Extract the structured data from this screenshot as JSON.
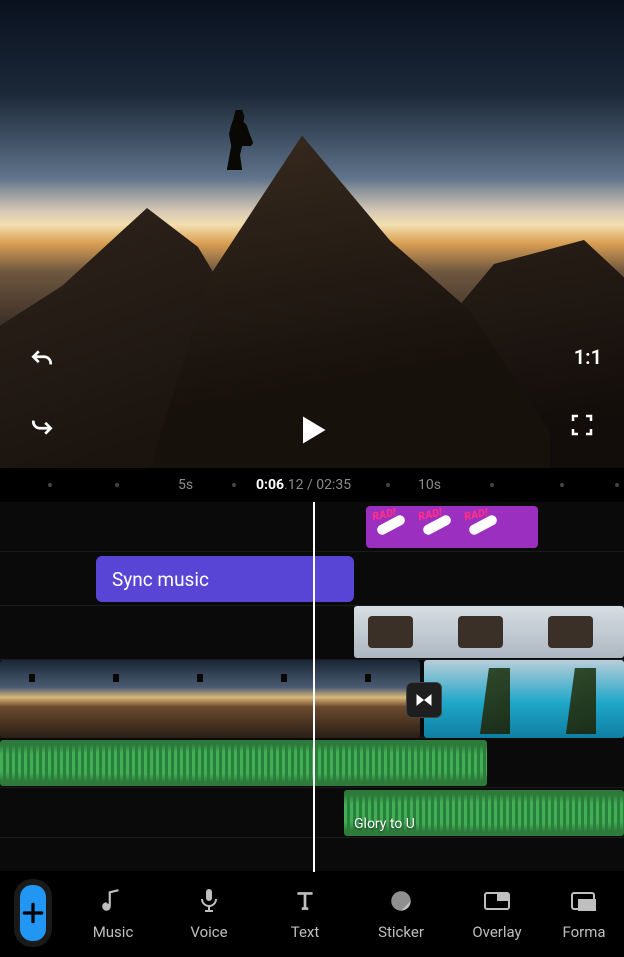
{
  "preview": {
    "aspect_ratio": "1:1"
  },
  "playback": {
    "current_seconds": "0:06",
    "current_frames": ".12",
    "separator": " / ",
    "total": "02:35"
  },
  "ruler": {
    "marker_5s": "5s",
    "marker_10s": "10s"
  },
  "timeline": {
    "sync_music_label": "Sync music",
    "sticker_label": "RAD!",
    "audio_track_2_label": "Glory to U"
  },
  "toolbar": {
    "music": "Music",
    "voice": "Voice",
    "text": "Text",
    "sticker": "Sticker",
    "overlay": "Overlay",
    "format": "Forma"
  }
}
